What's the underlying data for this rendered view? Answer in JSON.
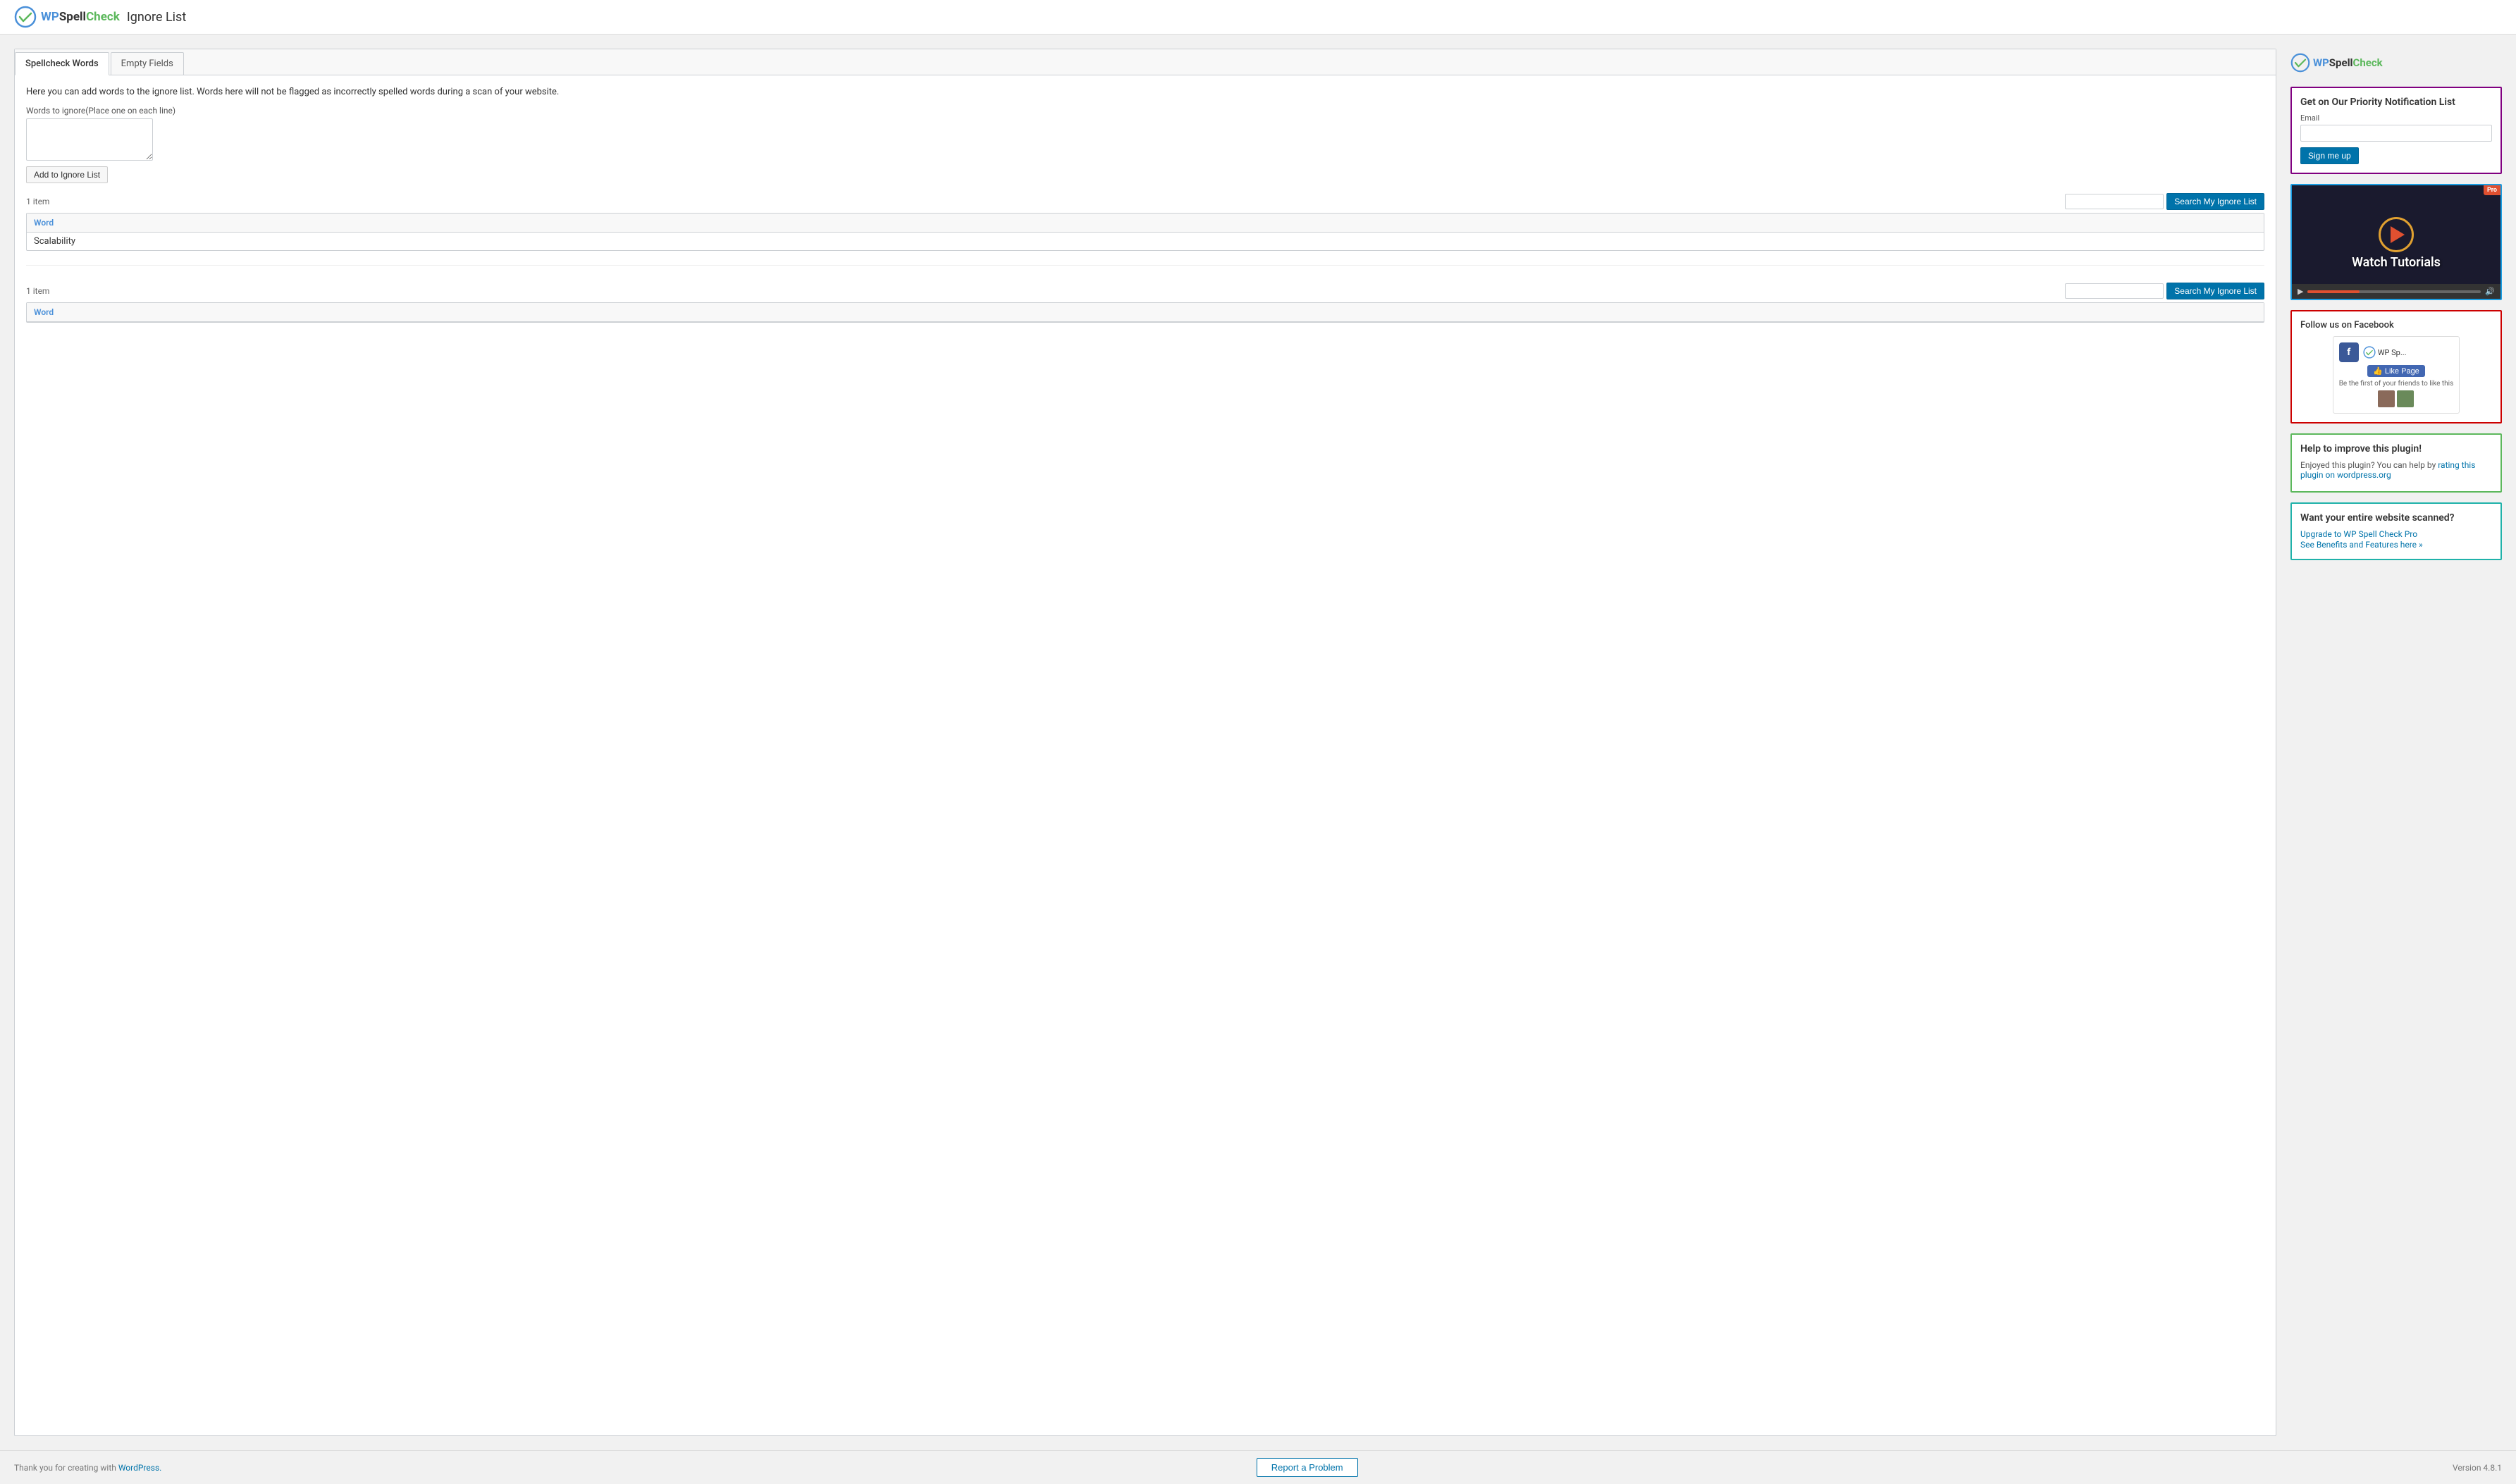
{
  "header": {
    "logo_wp": "WP",
    "logo_spell": "Spell",
    "logo_check": "Check",
    "page_title": "Ignore List"
  },
  "tabs": [
    {
      "id": "spellcheck-words",
      "label": "Spellcheck Words",
      "active": true
    },
    {
      "id": "empty-fields",
      "label": "Empty Fields",
      "active": false
    }
  ],
  "description": "Here you can add words to the ignore list. Words here will not be flagged as incorrectly spelled words during a scan of your website.",
  "words_label": "Words to ignore(Place one on each line)",
  "add_button": "Add to Ignore List",
  "table1": {
    "item_count": "1 item",
    "search_placeholder": "",
    "search_button": "Search My Ignore List",
    "column_header": "Word",
    "rows": [
      {
        "value": "Scalability"
      }
    ]
  },
  "table2": {
    "item_count": "1 item",
    "search_placeholder": "",
    "search_button": "Search My Ignore List",
    "column_header": "Word",
    "rows": []
  },
  "sidebar": {
    "logo_wp": "WP",
    "logo_spell": "Spell",
    "logo_check": "Check",
    "notification_widget": {
      "title": "Get on Our Priority Notification List",
      "email_label": "Email",
      "email_placeholder": "",
      "sign_up_button": "Sign me up"
    },
    "video_widget": {
      "watch_label": "Watch Tutorials",
      "pro_badge": "Pro"
    },
    "facebook_widget": {
      "title": "Follow us on Facebook",
      "page_name": "WP Sp...",
      "like_button": "Like Page",
      "friends_text": "Be the first of your friends to like this"
    },
    "help_widget": {
      "title": "Help to improve this plugin!",
      "text": "Enjoyed this plugin? You can help by ",
      "link_text": "rating this plugin on wordpress.org",
      "link_href": "#"
    },
    "upgrade_widget": {
      "title": "Want your entire website scanned?",
      "upgrade_link": "Upgrade to WP Spell Check Pro",
      "benefits_link": "See Benefits and Features here »"
    }
  },
  "footer": {
    "thank_you_text": "Thank you for creating with ",
    "wordpress_link": "WordPress.",
    "report_button": "Report a Problem",
    "version": "Version 4.8.1"
  }
}
